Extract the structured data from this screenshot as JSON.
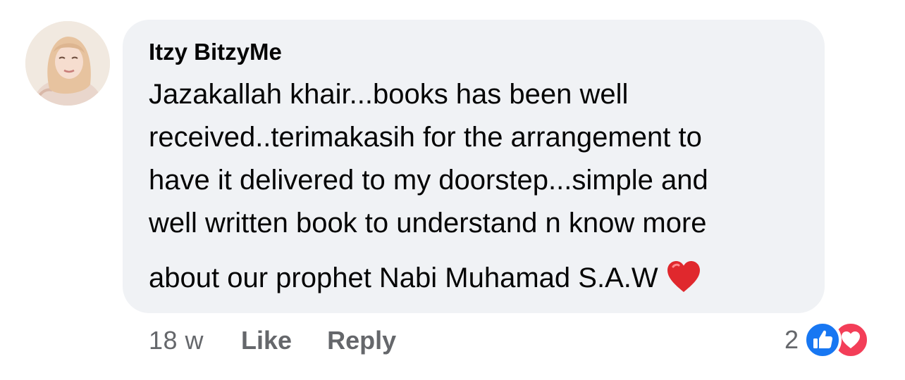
{
  "comment": {
    "author": "Itzy BitzyMe",
    "text_lines": [
      "Jazakallah khair...books has been well",
      "received..terimakasih for the arrangement to",
      "have it delivered to my doorstep...simple and",
      "well written book to understand n know more",
      "about our prophet Nabi Muhamad S.A.W"
    ],
    "emoji": "heart-emoji"
  },
  "actions": {
    "time": "18 w",
    "like_label": "Like",
    "reply_label": "Reply"
  },
  "reactions": {
    "count": "2",
    "types": [
      "like",
      "love"
    ]
  },
  "colors": {
    "bubble_bg": "#f0f2f5",
    "text": "#050505",
    "secondary_text": "#65676b",
    "like_blue": "#1877f2",
    "love_red": "#f33e58"
  }
}
